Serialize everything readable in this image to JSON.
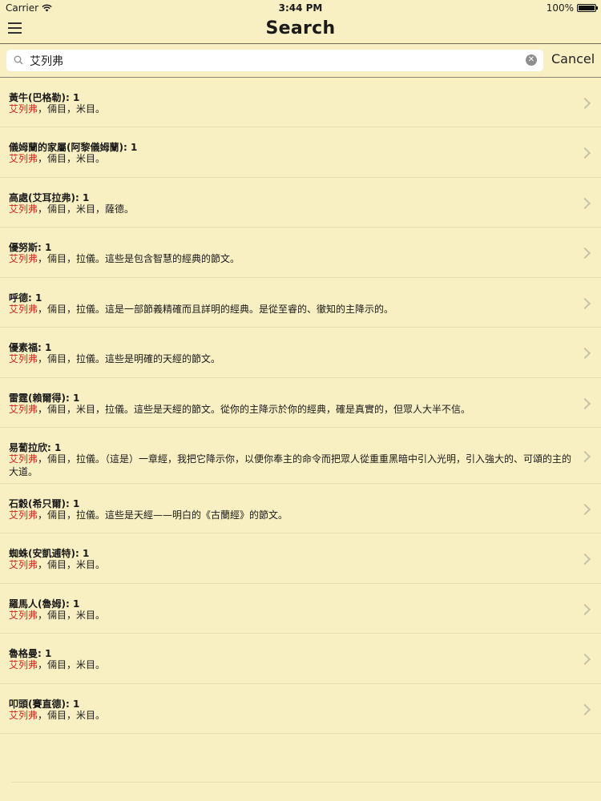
{
  "status_bar": {
    "carrier": "Carrier",
    "time": "3:44 PM",
    "battery": "100%"
  },
  "nav": {
    "title": "Search"
  },
  "search": {
    "value": "艾列弗",
    "cancel_label": "Cancel"
  },
  "results": [
    {
      "title": "黃牛(巴格勒): 1",
      "highlight": "艾列弗",
      "rest": "，倆目，米目。"
    },
    {
      "title": "儀姆蘭的家屬(阿黎儀姆蘭): 1",
      "highlight": "艾列弗",
      "rest": "，倆目，米目。"
    },
    {
      "title": "高處(艾耳拉弗): 1",
      "highlight": "艾列弗",
      "rest": "，倆目，米目，薩德。"
    },
    {
      "title": "優努斯: 1",
      "highlight": "艾列弗",
      "rest": "，倆目，拉儀。這些是包含智慧的經典的節文。"
    },
    {
      "title": "呼德: 1",
      "highlight": "艾列弗",
      "rest": "，倆目，拉儀。這是一部節義精確而且詳明的經典。是從至睿的、徹知的主降示的。"
    },
    {
      "title": "優素福: 1",
      "highlight": "艾列弗",
      "rest": "，倆目，拉儀。這些是明確的天經的節文。"
    },
    {
      "title": "雷霆(賴爾得): 1",
      "highlight": "艾列弗",
      "rest": "，倆目，米目，拉儀。這些是天經的節文。從你的主降示於你的經典，確是真實的，但眾人大半不信。"
    },
    {
      "title": "易蔔拉欣: 1",
      "highlight": "艾列弗",
      "rest": "，倆目，拉儀。（這是）一章經，我把它降示你，以便你奉主的命令而把眾人從重重黑暗中引入光明，引入強大的、可頌的主的大道。"
    },
    {
      "title": "石穀(希只爾): 1",
      "highlight": "艾列弗",
      "rest": "，倆目，拉儀。這些是天經——明白的《古蘭經》的節文。"
    },
    {
      "title": "蜘蛛(安凱逋特): 1",
      "highlight": "艾列弗",
      "rest": "，倆目，米目。"
    },
    {
      "title": "羅馬人(魯姆): 1",
      "highlight": "艾列弗",
      "rest": "，倆目，米目。"
    },
    {
      "title": "魯格曼: 1",
      "highlight": "艾列弗",
      "rest": "，倆目，米目。"
    },
    {
      "title": "叩頭(賽直德): 1",
      "highlight": "艾列弗",
      "rest": "，倆目，米目。"
    }
  ],
  "colors": {
    "background": "#f8efc3",
    "highlight": "#d2261b",
    "chevron": "#c7c2a8"
  },
  "icons": {
    "menu": "hamburger-menu-icon",
    "search": "search-icon",
    "clear": "clear-icon",
    "chevron": "chevron-right-icon",
    "wifi": "wifi-icon",
    "battery": "battery-icon"
  }
}
